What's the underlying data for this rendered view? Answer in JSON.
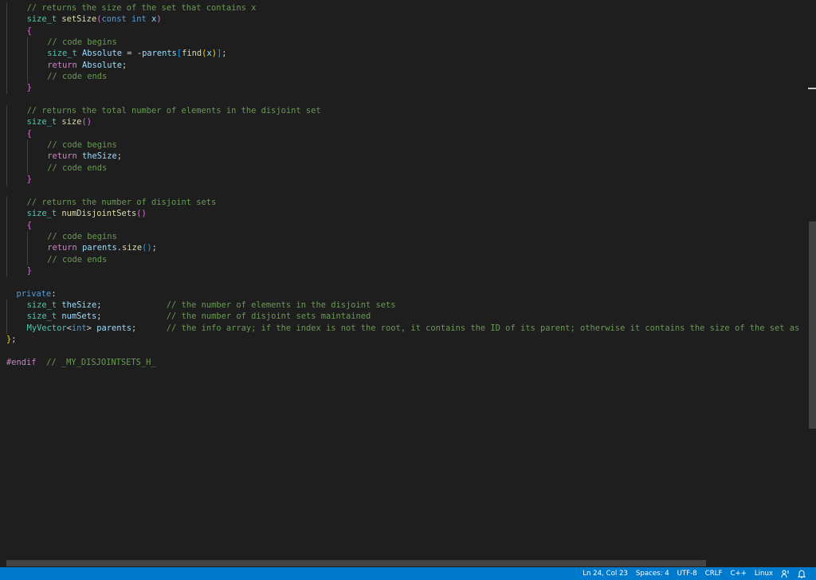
{
  "editor": {
    "language": "C++",
    "lines": [
      {
        "indent": 1,
        "segments": [
          {
            "s": "c",
            "t": "// returns the size of the set that contains x"
          }
        ]
      },
      {
        "indent": 1,
        "segments": [
          {
            "s": "t",
            "t": "size_t"
          },
          {
            "s": "p",
            "t": " "
          },
          {
            "s": "f",
            "t": "setSize"
          },
          {
            "s": "b1",
            "t": "("
          },
          {
            "s": "k",
            "t": "const"
          },
          {
            "s": "p",
            "t": " "
          },
          {
            "s": "k",
            "t": "int"
          },
          {
            "s": "p",
            "t": " "
          },
          {
            "s": "v",
            "t": "x"
          },
          {
            "s": "b1",
            "t": ")"
          }
        ]
      },
      {
        "indent": 1,
        "segments": [
          {
            "s": "b1",
            "t": "{"
          }
        ]
      },
      {
        "indent": 2,
        "segments": [
          {
            "s": "c",
            "t": "// code begins"
          }
        ]
      },
      {
        "indent": 2,
        "segments": [
          {
            "s": "t",
            "t": "size_t"
          },
          {
            "s": "p",
            "t": " "
          },
          {
            "s": "v",
            "t": "Absolute"
          },
          {
            "s": "p",
            "t": " = -"
          },
          {
            "s": "v",
            "t": "parents"
          },
          {
            "s": "b2",
            "t": "["
          },
          {
            "s": "f",
            "t": "find"
          },
          {
            "s": "b3",
            "t": "("
          },
          {
            "s": "v",
            "t": "x"
          },
          {
            "s": "b3",
            "t": ")"
          },
          {
            "s": "b2",
            "t": "]"
          },
          {
            "s": "p",
            "t": ";"
          }
        ]
      },
      {
        "indent": 2,
        "segments": [
          {
            "s": "kw",
            "t": "return"
          },
          {
            "s": "p",
            "t": " "
          },
          {
            "s": "v",
            "t": "Absolute"
          },
          {
            "s": "p",
            "t": ";"
          }
        ]
      },
      {
        "indent": 2,
        "segments": [
          {
            "s": "c",
            "t": "// code ends"
          }
        ]
      },
      {
        "indent": 1,
        "segments": [
          {
            "s": "b1",
            "t": "}"
          }
        ]
      },
      {
        "indent": 0,
        "segments": []
      },
      {
        "indent": 1,
        "segments": [
          {
            "s": "c",
            "t": "// returns the total number of elements in the disjoint set"
          }
        ]
      },
      {
        "indent": 1,
        "segments": [
          {
            "s": "t",
            "t": "size_t"
          },
          {
            "s": "p",
            "t": " "
          },
          {
            "s": "f",
            "t": "size"
          },
          {
            "s": "b1",
            "t": "()"
          }
        ]
      },
      {
        "indent": 1,
        "segments": [
          {
            "s": "b1",
            "t": "{"
          }
        ]
      },
      {
        "indent": 2,
        "segments": [
          {
            "s": "c",
            "t": "// code begins"
          }
        ]
      },
      {
        "indent": 2,
        "segments": [
          {
            "s": "kw",
            "t": "return"
          },
          {
            "s": "p",
            "t": " "
          },
          {
            "s": "v",
            "t": "theSize"
          },
          {
            "s": "p",
            "t": ";"
          }
        ]
      },
      {
        "indent": 2,
        "segments": [
          {
            "s": "c",
            "t": "// code ends"
          }
        ]
      },
      {
        "indent": 1,
        "segments": [
          {
            "s": "b1",
            "t": "}"
          }
        ]
      },
      {
        "indent": 0,
        "segments": []
      },
      {
        "indent": 1,
        "segments": [
          {
            "s": "c",
            "t": "// returns the number of disjoint sets"
          }
        ]
      },
      {
        "indent": 1,
        "segments": [
          {
            "s": "t",
            "t": "size_t"
          },
          {
            "s": "p",
            "t": " "
          },
          {
            "s": "f",
            "t": "numDisjointSets"
          },
          {
            "s": "b1",
            "t": "()"
          }
        ]
      },
      {
        "indent": 1,
        "segments": [
          {
            "s": "b1",
            "t": "{"
          }
        ]
      },
      {
        "indent": 2,
        "segments": [
          {
            "s": "c",
            "t": "// code begins"
          }
        ]
      },
      {
        "indent": 2,
        "segments": [
          {
            "s": "kw",
            "t": "return"
          },
          {
            "s": "p",
            "t": " "
          },
          {
            "s": "v",
            "t": "parents"
          },
          {
            "s": "p",
            "t": "."
          },
          {
            "s": "f",
            "t": "size"
          },
          {
            "s": "b2",
            "t": "()"
          },
          {
            "s": "p",
            "t": ";"
          }
        ]
      },
      {
        "indent": 2,
        "segments": [
          {
            "s": "c",
            "t": "// code ends"
          }
        ]
      },
      {
        "indent": 1,
        "segments": [
          {
            "s": "b1",
            "t": "}"
          }
        ]
      },
      {
        "indent": 0,
        "segments": []
      },
      {
        "indent": 0,
        "segments": [
          {
            "s": "p",
            "t": "  "
          },
          {
            "s": "k",
            "t": "private"
          },
          {
            "s": "p",
            "t": ":"
          }
        ]
      },
      {
        "indent": 1,
        "segments": [
          {
            "s": "t",
            "t": "size_t"
          },
          {
            "s": "p",
            "t": " "
          },
          {
            "s": "v",
            "t": "theSize"
          },
          {
            "s": "p",
            "t": ";             "
          },
          {
            "s": "c",
            "t": "// the number of elements in the disjoint sets"
          }
        ]
      },
      {
        "indent": 1,
        "segments": [
          {
            "s": "t",
            "t": "size_t"
          },
          {
            "s": "p",
            "t": " "
          },
          {
            "s": "v",
            "t": "numSets"
          },
          {
            "s": "p",
            "t": ";             "
          },
          {
            "s": "c",
            "t": "// the number of disjoint sets maintained"
          }
        ]
      },
      {
        "indent": 1,
        "segments": [
          {
            "s": "t",
            "t": "MyVector"
          },
          {
            "s": "p",
            "t": "<"
          },
          {
            "s": "k",
            "t": "int"
          },
          {
            "s": "p",
            "t": "> "
          },
          {
            "s": "v",
            "t": "parents"
          },
          {
            "s": "p",
            "t": ";      "
          },
          {
            "s": "c",
            "t": "// the info array; if the index is not the root, it contains the ID of its parent; otherwise it contains the size of the set as"
          }
        ]
      },
      {
        "indent": 0,
        "segments": [
          {
            "s": "b3",
            "t": "}"
          },
          {
            "s": "p",
            "t": ";"
          }
        ]
      },
      {
        "indent": 0,
        "segments": []
      },
      {
        "indent": 0,
        "segments": [
          {
            "s": "pp",
            "t": "#endif"
          },
          {
            "s": "p",
            "t": "  "
          },
          {
            "s": "c",
            "t": "// _MY_DISJOINTSETS_H_"
          }
        ]
      }
    ]
  },
  "statusbar": {
    "position": "Ln 24, Col 23",
    "spaces": "Spaces: 4",
    "encoding": "UTF-8",
    "eol": "CRLF",
    "language": "C++",
    "platform": "Linux",
    "feedback_icon": "feedback-icon",
    "bell_icon": "bell-icon"
  },
  "colors": {
    "background": "#1e1e1e",
    "statusbar": "#007acc",
    "comment": "#6a9955",
    "type": "#4ec9b0",
    "keyword": "#569cd6",
    "control": "#c586c0",
    "function": "#dcdcaa",
    "variable": "#9cdcfe"
  }
}
